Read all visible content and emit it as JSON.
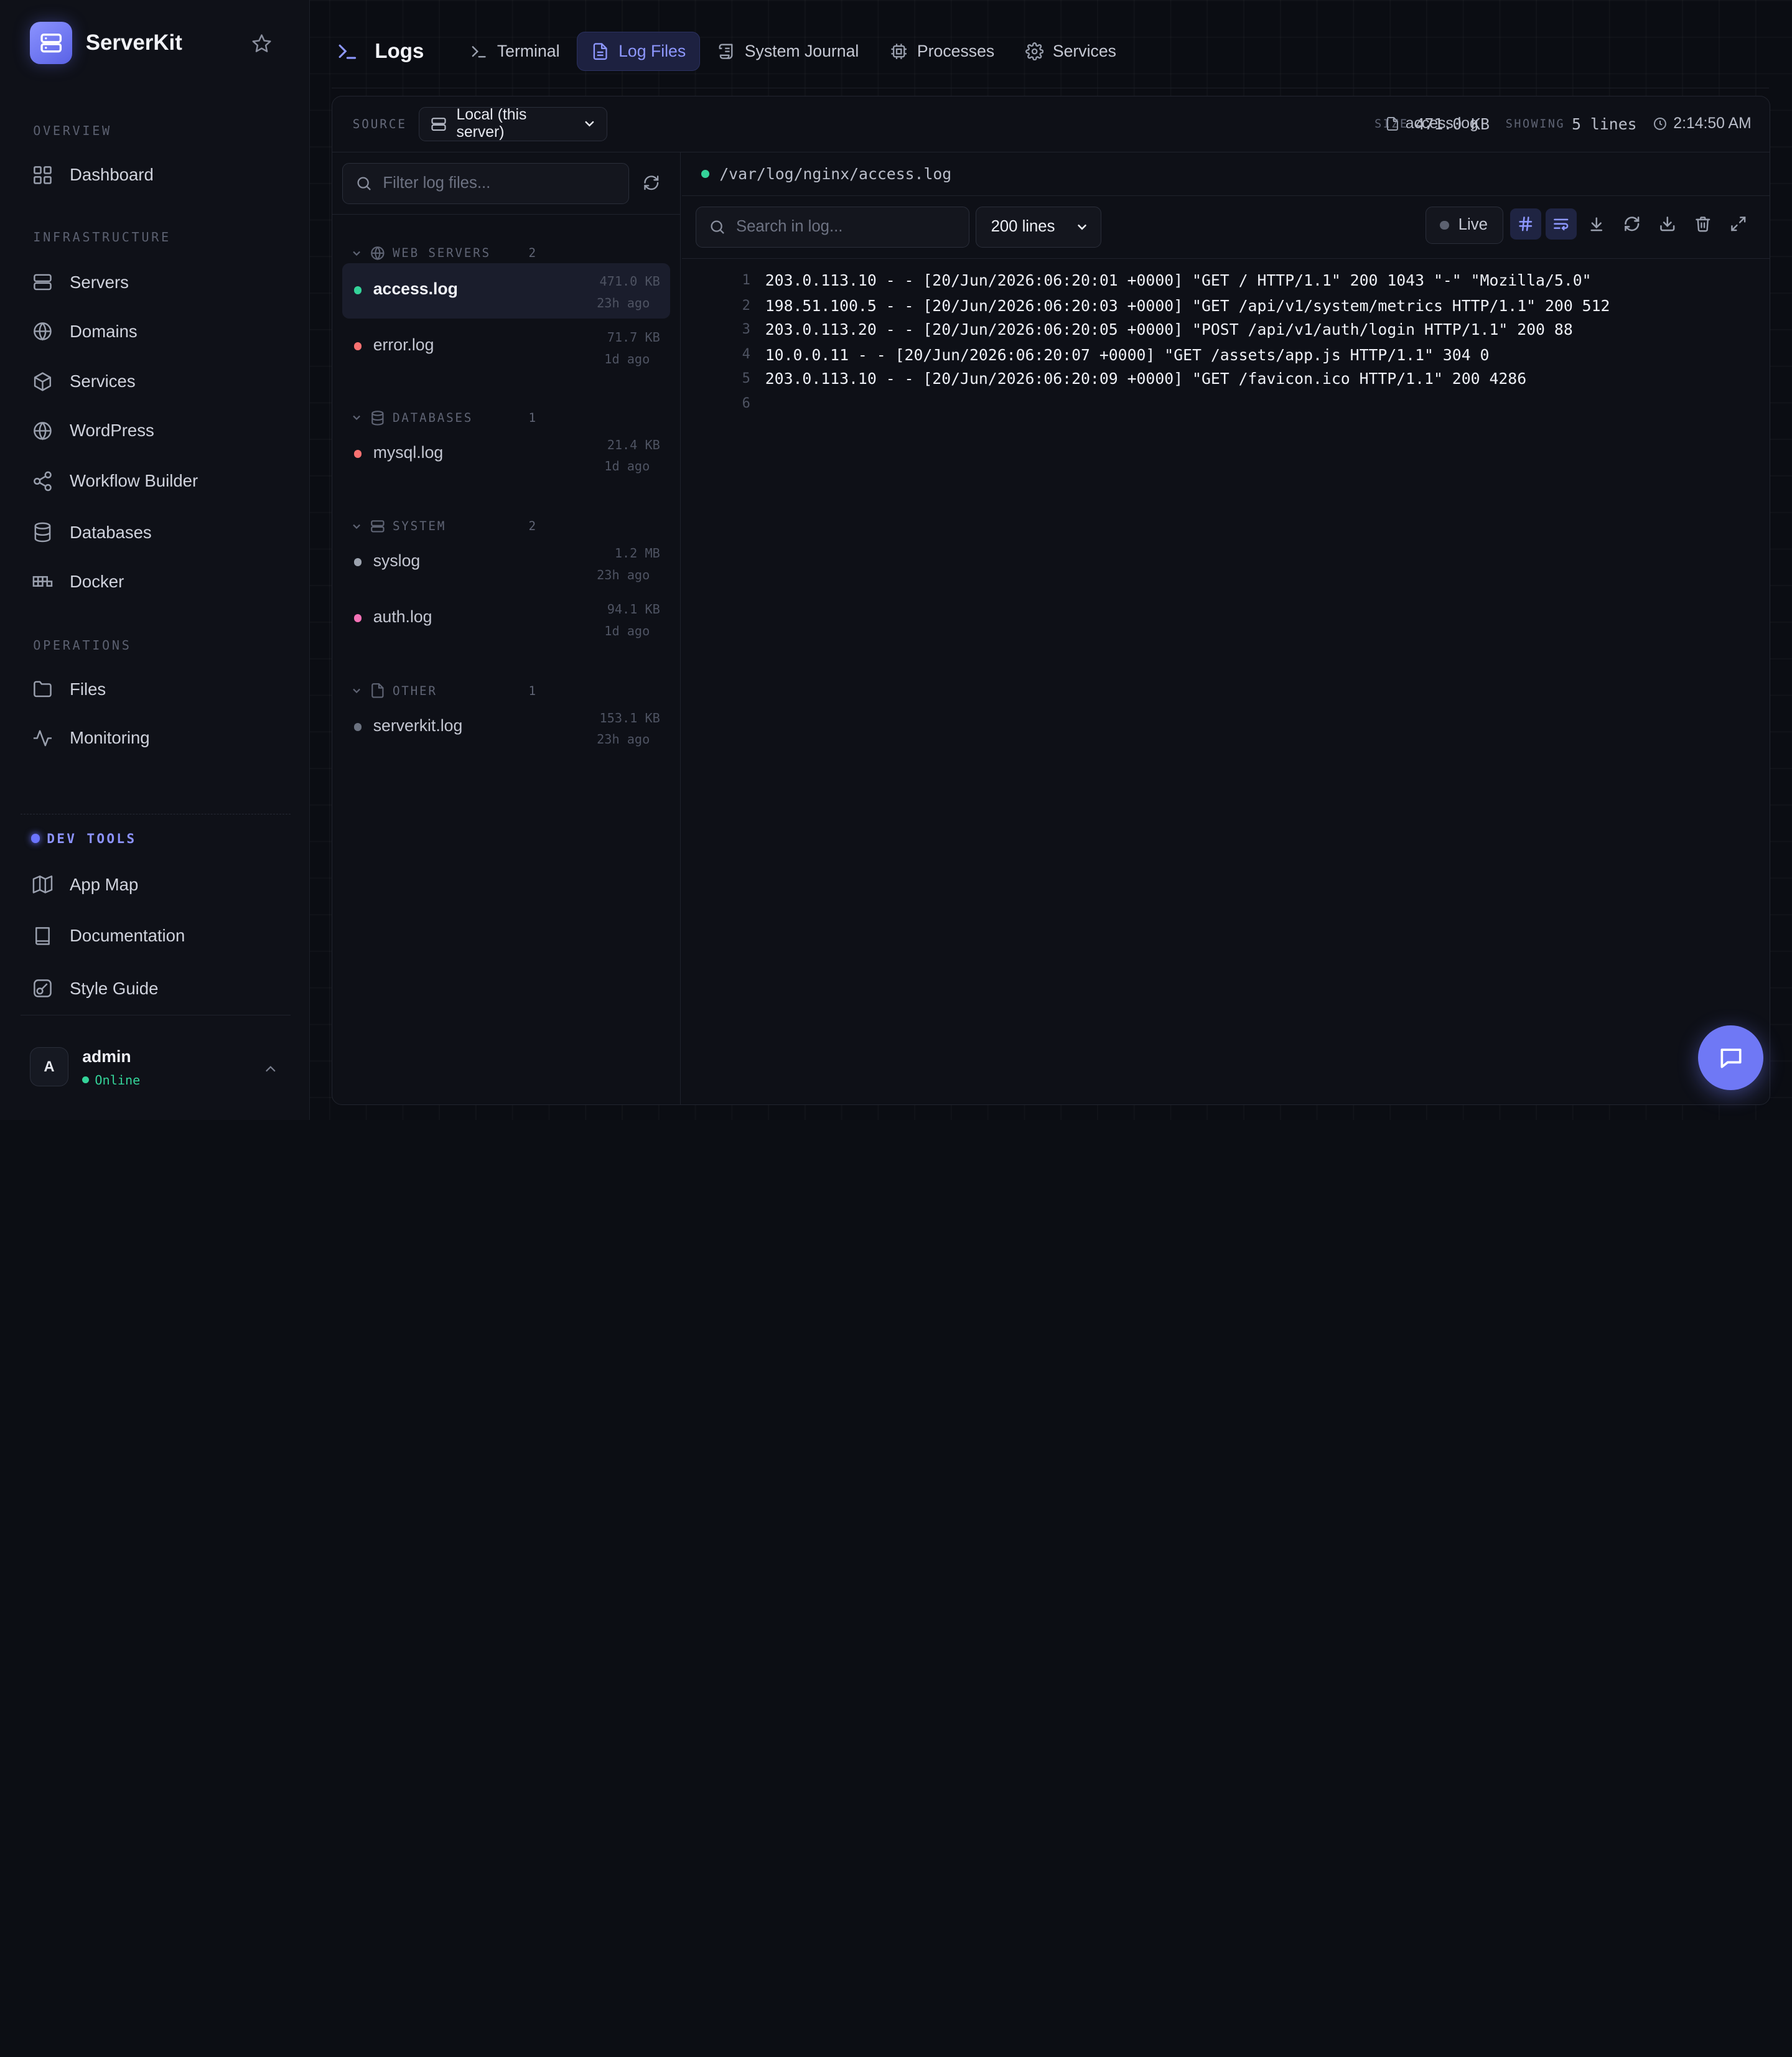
{
  "brand": {
    "name": "ServerKit"
  },
  "sidebar": {
    "sections": {
      "overview": "OVERVIEW",
      "infrastructure": "INFRASTRUCTURE",
      "operations": "OPERATIONS"
    },
    "items": {
      "dashboard": "Dashboard",
      "servers": "Servers",
      "domains": "Domains",
      "services": "Services",
      "wordpress": "WordPress",
      "workflow": "Workflow Builder",
      "databases": "Databases",
      "docker": "Docker",
      "files": "Files",
      "monitoring": "Monitoring"
    },
    "devtools": {
      "label": "DEV TOOLS",
      "app_map": "App Map",
      "documentation": "Documentation",
      "style_guide": "Style Guide"
    },
    "user": {
      "initial": "A",
      "name": "admin",
      "status": "Online"
    }
  },
  "header": {
    "title": "Logs",
    "tabs": {
      "terminal": "Terminal",
      "log_files": "Log Files",
      "journal": "System Journal",
      "processes": "Processes",
      "services": "Services"
    },
    "active_tab": "log_files"
  },
  "source": {
    "label": "SOURCE",
    "selected": "Local (this server)"
  },
  "meta": {
    "file": "access.log",
    "size_label": "SIZE",
    "size": "471.0 KB",
    "showing_label": "SHOWING",
    "showing": "5 lines",
    "time": "2:14:50 AM"
  },
  "file_list": {
    "filter_placeholder": "Filter log files...",
    "groups": {
      "web": {
        "label": "WEB SERVERS",
        "count": "2"
      },
      "db": {
        "label": "DATABASES",
        "count": "1"
      },
      "system": {
        "label": "SYSTEM",
        "count": "2"
      },
      "other": {
        "label": "OTHER",
        "count": "1"
      }
    },
    "files": {
      "access": {
        "name": "access.log",
        "size": "471.0 KB",
        "age": "23h ago",
        "color": "#34d399"
      },
      "error": {
        "name": "error.log",
        "size": "71.7 KB",
        "age": "1d ago",
        "color": "#f87171"
      },
      "mysql": {
        "name": "mysql.log",
        "size": "21.4 KB",
        "age": "1d ago",
        "color": "#f87171"
      },
      "syslog": {
        "name": "syslog",
        "size": "1.2 MB",
        "age": "23h ago",
        "color": "#9ca3af"
      },
      "auth": {
        "name": "auth.log",
        "size": "94.1 KB",
        "age": "1d ago",
        "color": "#f472b6"
      },
      "serverkit": {
        "name": "serverkit.log",
        "size": "153.1 KB",
        "age": "23h ago",
        "color": "#6b7280"
      }
    }
  },
  "viewer": {
    "path": "/var/log/nginx/access.log",
    "search_placeholder": "Search in log...",
    "lines_option": "200 lines",
    "live_label": "Live",
    "lines": [
      {
        "n": "1",
        "text": "203.0.113.10 - - [20/Jun/2026:06:20:01 +0000] \"GET / HTTP/1.1\" 200 1043 \"-\" \"Mozilla/5.0\""
      },
      {
        "n": "2",
        "text": "198.51.100.5 - - [20/Jun/2026:06:20:03 +0000] \"GET /api/v1/system/metrics HTTP/1.1\" 200 512"
      },
      {
        "n": "3",
        "text": "203.0.113.20 - - [20/Jun/2026:06:20:05 +0000] \"POST /api/v1/auth/login HTTP/1.1\" 200 88"
      },
      {
        "n": "4",
        "text": "10.0.0.11 - - [20/Jun/2026:06:20:07 +0000] \"GET /assets/app.js HTTP/1.1\" 304 0"
      },
      {
        "n": "5",
        "text": "203.0.113.10 - - [20/Jun/2026:06:20:09 +0000] \"GET /favicon.ico HTTP/1.1\" 200 4286"
      },
      {
        "n": "6",
        "text": ""
      }
    ]
  },
  "colors": {
    "accent": "#6f78f5",
    "success": "#34d399",
    "danger": "#f87171"
  }
}
